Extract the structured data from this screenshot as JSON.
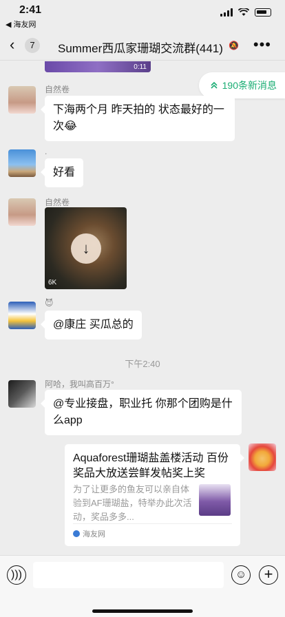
{
  "status_bar": {
    "time": "2:41",
    "back_app": "◀ 海友网"
  },
  "nav": {
    "back_count": "7",
    "title": "Summer西瓜家珊瑚交流群(441)",
    "more": "•••"
  },
  "video": {
    "duration": "0:11"
  },
  "new_messages": {
    "label": "190条新消息"
  },
  "messages": [
    {
      "sender": "自然卷",
      "text": "下海两个月 昨天拍的 状态最好的一次😂"
    },
    {
      "sender": ".",
      "text": "好看"
    },
    {
      "sender": "自然卷",
      "image_size": "6K"
    },
    {
      "sender": "😈",
      "text": "@康庄 买瓜总的"
    },
    {
      "sender": "阿哈，我叫高百万°",
      "text": "@专业接盘，职业托 你那个团购是什么app"
    }
  ],
  "time_divider": "下午2:40",
  "link_card": {
    "title": "Aquaforest珊瑚盐盖楼活动 百份奖品大放送尝鲜发帖奖上奖",
    "desc": "为了让更多的鱼友可以亲自体验到AF珊瑚盐，特举办此次活动，奖品多多...",
    "source": "海友网"
  }
}
